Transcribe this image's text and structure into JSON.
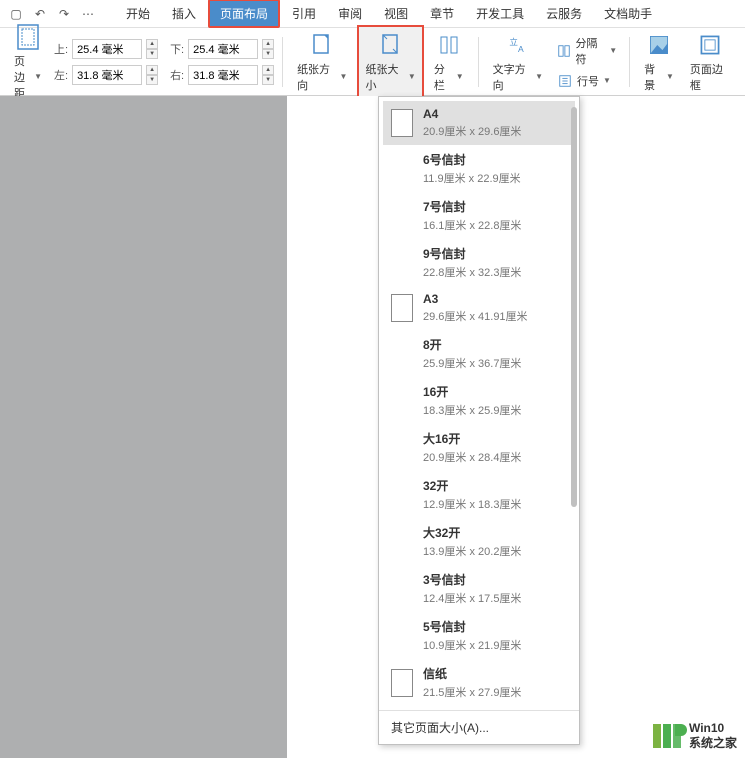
{
  "menu": {
    "tabs": [
      "开始",
      "插入",
      "页面布局",
      "引用",
      "审阅",
      "视图",
      "章节",
      "开发工具",
      "云服务",
      "文档助手"
    ],
    "active_index": 2
  },
  "margins": {
    "page_margin_label": "页边距",
    "top_label": "上:",
    "bottom_label": "下:",
    "left_label": "左:",
    "right_label": "右:",
    "top_value": "25.4 毫米",
    "bottom_value": "25.4 毫米",
    "left_value": "31.8 毫米",
    "right_value": "31.8 毫米"
  },
  "ribbon": {
    "orientation": "纸张方向",
    "paper_size": "纸张大小",
    "columns": "分栏",
    "text_direction": "文字方向",
    "separator": "分隔符",
    "line_number": "行号",
    "background": "背景",
    "page_border": "页面边框"
  },
  "paper_sizes": [
    {
      "name": "A4",
      "dims": "20.9厘米  x  29.6厘米",
      "icon": true,
      "selected": true
    },
    {
      "name": "6号信封",
      "dims": "11.9厘米  x  22.9厘米",
      "icon": false
    },
    {
      "name": "7号信封",
      "dims": "16.1厘米  x  22.8厘米",
      "icon": false
    },
    {
      "name": "9号信封",
      "dims": "22.8厘米  x  32.3厘米",
      "icon": false
    },
    {
      "name": "A3",
      "dims": "29.6厘米  x  41.91厘米",
      "icon": true
    },
    {
      "name": "8开",
      "dims": "25.9厘米  x  36.7厘米",
      "icon": false
    },
    {
      "name": "16开",
      "dims": "18.3厘米  x  25.9厘米",
      "icon": false
    },
    {
      "name": "大16开",
      "dims": "20.9厘米  x  28.4厘米",
      "icon": false
    },
    {
      "name": "32开",
      "dims": "12.9厘米  x  18.3厘米",
      "icon": false
    },
    {
      "name": "大32开",
      "dims": "13.9厘米  x  20.2厘米",
      "icon": false
    },
    {
      "name": "3号信封",
      "dims": "12.4厘米  x  17.5厘米",
      "icon": false
    },
    {
      "name": "5号信封",
      "dims": "10.9厘米  x  21.9厘米",
      "icon": false
    },
    {
      "name": "信纸",
      "dims": "21.5厘米  x  27.9厘米",
      "icon": true
    }
  ],
  "paper_footer": "其它页面大小(A)...",
  "watermark": {
    "line1": "Win10",
    "line2": "系统之家"
  }
}
